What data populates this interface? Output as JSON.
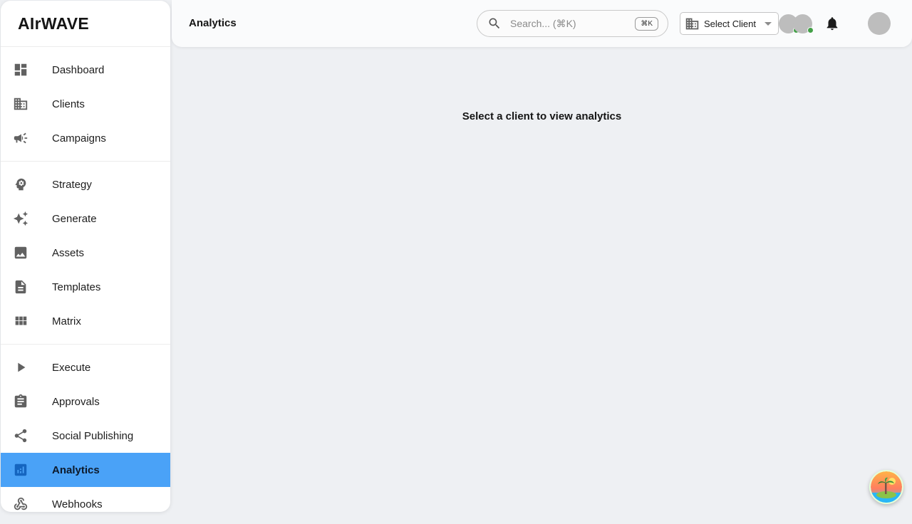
{
  "brand": {
    "name": "AIrWAVE"
  },
  "sidebar": {
    "groups": [
      {
        "items": [
          {
            "label": "Dashboard",
            "icon": "dashboard-icon"
          },
          {
            "label": "Clients",
            "icon": "building-icon"
          },
          {
            "label": "Campaigns",
            "icon": "megaphone-icon"
          }
        ]
      },
      {
        "items": [
          {
            "label": "Strategy",
            "icon": "psychology-head-icon"
          },
          {
            "label": "Generate",
            "icon": "sparkles-icon"
          },
          {
            "label": "Assets",
            "icon": "image-icon"
          },
          {
            "label": "Templates",
            "icon": "document-icon"
          },
          {
            "label": "Matrix",
            "icon": "grid-icon"
          }
        ]
      },
      {
        "items": [
          {
            "label": "Execute",
            "icon": "play-icon"
          },
          {
            "label": "Approvals",
            "icon": "clipboard-icon"
          },
          {
            "label": "Social Publishing",
            "icon": "share-icon"
          },
          {
            "label": "Analytics",
            "icon": "analytics-icon",
            "active": true
          },
          {
            "label": "Webhooks",
            "icon": "webhook-icon"
          }
        ]
      }
    ],
    "active_color": "#4aa2f7"
  },
  "header": {
    "title": "Analytics",
    "search": {
      "placeholder": "Search... (⌘K)",
      "shortcut": "⌘K"
    },
    "client_select": {
      "label": "Select Client"
    }
  },
  "main": {
    "empty_message": "Select a client to view analytics"
  },
  "colors": {
    "online": "#43a047",
    "avatar_placeholder": "#bdbdbd"
  }
}
